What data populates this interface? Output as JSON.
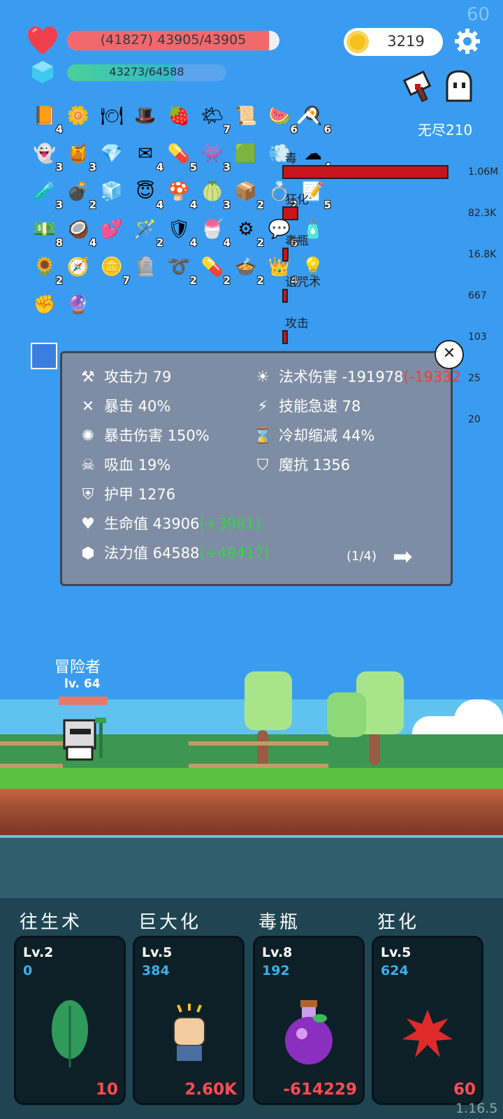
{
  "fps": "60",
  "hp": {
    "text": "(41827) 43905/43905",
    "fill": 0.95
  },
  "mp": {
    "text": "43273/64588",
    "fill": 0.67
  },
  "coins": "3219",
  "mode": "无尽210",
  "items": [
    {
      "icon": "book-icon",
      "glyph": "📙",
      "count": "4"
    },
    {
      "icon": "flower-icon",
      "glyph": "🌼",
      "count": ""
    },
    {
      "icon": "menu-board-icon",
      "glyph": "🍽",
      "count": ""
    },
    {
      "icon": "wizard-hat-icon",
      "glyph": "🎩",
      "count": ""
    },
    {
      "icon": "strawberry-icon",
      "glyph": "🍓",
      "count": ""
    },
    {
      "icon": "sun-cloud-icon",
      "glyph": "🌤",
      "count": "7"
    },
    {
      "icon": "scroll-icon",
      "glyph": "📜",
      "count": ""
    },
    {
      "icon": "watermelon-icon",
      "glyph": "🍉",
      "count": "6"
    },
    {
      "icon": "egg-icon",
      "glyph": "🍳",
      "count": "6"
    },
    {
      "icon": "ghost-icon",
      "glyph": "👻",
      "count": "3"
    },
    {
      "icon": "jam-jar-icon",
      "glyph": "🍯",
      "count": "3"
    },
    {
      "icon": "ruby-icon",
      "glyph": "💎",
      "count": ""
    },
    {
      "icon": "envelope-icon",
      "glyph": "✉",
      "count": "4"
    },
    {
      "icon": "pill-icon",
      "glyph": "💊",
      "count": "5"
    },
    {
      "icon": "monster-icon",
      "glyph": "👾",
      "count": "3"
    },
    {
      "icon": "green-card-icon",
      "glyph": "🟩",
      "count": ""
    },
    {
      "icon": "wind-icon",
      "glyph": "💨",
      "count": ""
    },
    {
      "icon": "cloud-icon",
      "glyph": "☁",
      "count": "4"
    },
    {
      "icon": "potion-flask-icon",
      "glyph": "🧪",
      "count": "3"
    },
    {
      "icon": "grenade-icon",
      "glyph": "💣",
      "count": "2"
    },
    {
      "icon": "ice-cube-icon",
      "glyph": "🧊",
      "count": ""
    },
    {
      "icon": "halo-icon",
      "glyph": "😇",
      "count": "4"
    },
    {
      "icon": "mushroom-icon",
      "glyph": "🍄",
      "count": "4"
    },
    {
      "icon": "lime-icon",
      "glyph": "🍈",
      "count": "3"
    },
    {
      "icon": "purple-box-icon",
      "glyph": "📦",
      "count": "2"
    },
    {
      "icon": "ring-icon",
      "glyph": "💍",
      "count": "2"
    },
    {
      "icon": "note-pencil-icon",
      "glyph": "📝",
      "count": "5"
    },
    {
      "icon": "cash-heart-icon",
      "glyph": "💵",
      "count": "8"
    },
    {
      "icon": "coconut-icon",
      "glyph": "🥥",
      "count": "4"
    },
    {
      "icon": "hearts-icon",
      "glyph": "💕",
      "count": ""
    },
    {
      "icon": "magic-wand-icon",
      "glyph": "🪄",
      "count": "2"
    },
    {
      "icon": "shield-icon",
      "glyph": "🛡",
      "count": "4"
    },
    {
      "icon": "ice-cream-icon",
      "glyph": "🍧",
      "count": "4"
    },
    {
      "icon": "spiked-mace-icon",
      "glyph": "⚙",
      "count": "2"
    },
    {
      "icon": "speech-bubble-icon",
      "glyph": "💬",
      "count": "6"
    },
    {
      "icon": "spray-bottle-icon",
      "glyph": "🧴",
      "count": ""
    },
    {
      "icon": "sunflower-icon",
      "glyph": "🌻",
      "count": "2"
    },
    {
      "icon": "compass-icon",
      "glyph": "🧭",
      "count": ""
    },
    {
      "icon": "coin-stack-icon",
      "glyph": "🪙",
      "count": "7"
    },
    {
      "icon": "tombstone-icon",
      "glyph": "🪦",
      "count": ""
    },
    {
      "icon": "noose-icon",
      "glyph": "➰",
      "count": "2"
    },
    {
      "icon": "capsule-icon",
      "glyph": "💊",
      "count": "2"
    },
    {
      "icon": "cauldron-icon",
      "glyph": "🍲",
      "count": "2"
    },
    {
      "icon": "crown-icon",
      "glyph": "👑",
      "count": "4"
    },
    {
      "icon": "lightbulb-icon",
      "glyph": "💡",
      "count": ""
    },
    {
      "icon": "fist-icon",
      "glyph": "✊",
      "count": ""
    },
    {
      "icon": "crystal-ball-icon",
      "glyph": "🔮",
      "count": ""
    }
  ],
  "damage": [
    {
      "label": "毒",
      "value": "1.06M",
      "frac": 1.0
    },
    {
      "label": "狂化",
      "value": "82.3K",
      "frac": 0.08
    },
    {
      "label": "毒瓶",
      "value": "16.8K",
      "frac": 0.02
    },
    {
      "label": "诅咒术",
      "value": "667",
      "frac": 0.01
    },
    {
      "label": "攻击",
      "value": "103",
      "frac": 0.005
    },
    {
      "label": "",
      "value": "25",
      "frac": 0
    },
    {
      "label": "",
      "value": "20",
      "frac": 0
    }
  ],
  "stats": {
    "attack": "攻击力 79",
    "spell": "法术伤害 -191978",
    "spell_extra": "(-19332",
    "crit": "暴击 40%",
    "haste": "技能急速 78",
    "critdmg": "暴击伤害 150%",
    "cdr": "冷却缩减 44%",
    "lifesteal": "吸血 19%",
    "mres": "魔抗 1356",
    "armor": "护甲 1276",
    "hp_label": "生命值 43906",
    "hp_bonus": "(+3981)",
    "mp_label": "法力值 64588",
    "mp_bonus": "(+48417)",
    "page": "(1/4)"
  },
  "hero": {
    "name": "冒险者",
    "level": "lv. 64"
  },
  "skills": [
    {
      "name": "往生术",
      "lv": "Lv.2",
      "val": "0",
      "cost": "10",
      "icon": "leaf-icon"
    },
    {
      "name": "巨大化",
      "lv": "Lv.5",
      "val": "384",
      "cost": "2.60K",
      "icon": "fist-icon"
    },
    {
      "name": "毒瓶",
      "lv": "Lv.8",
      "val": "192",
      "cost": "-614229",
      "icon": "poison-bottle-icon"
    },
    {
      "name": "狂化",
      "lv": "Lv.5",
      "val": "624",
      "cost": "60",
      "icon": "blood-splat-icon"
    }
  ],
  "version": "1.16.5",
  "colors": {
    "sky": "#3a9cf0",
    "hp": "#f2686d",
    "panel": "#7e8da3",
    "damage_bar": "#c8141d",
    "skill_cost": "#ff4b54"
  }
}
